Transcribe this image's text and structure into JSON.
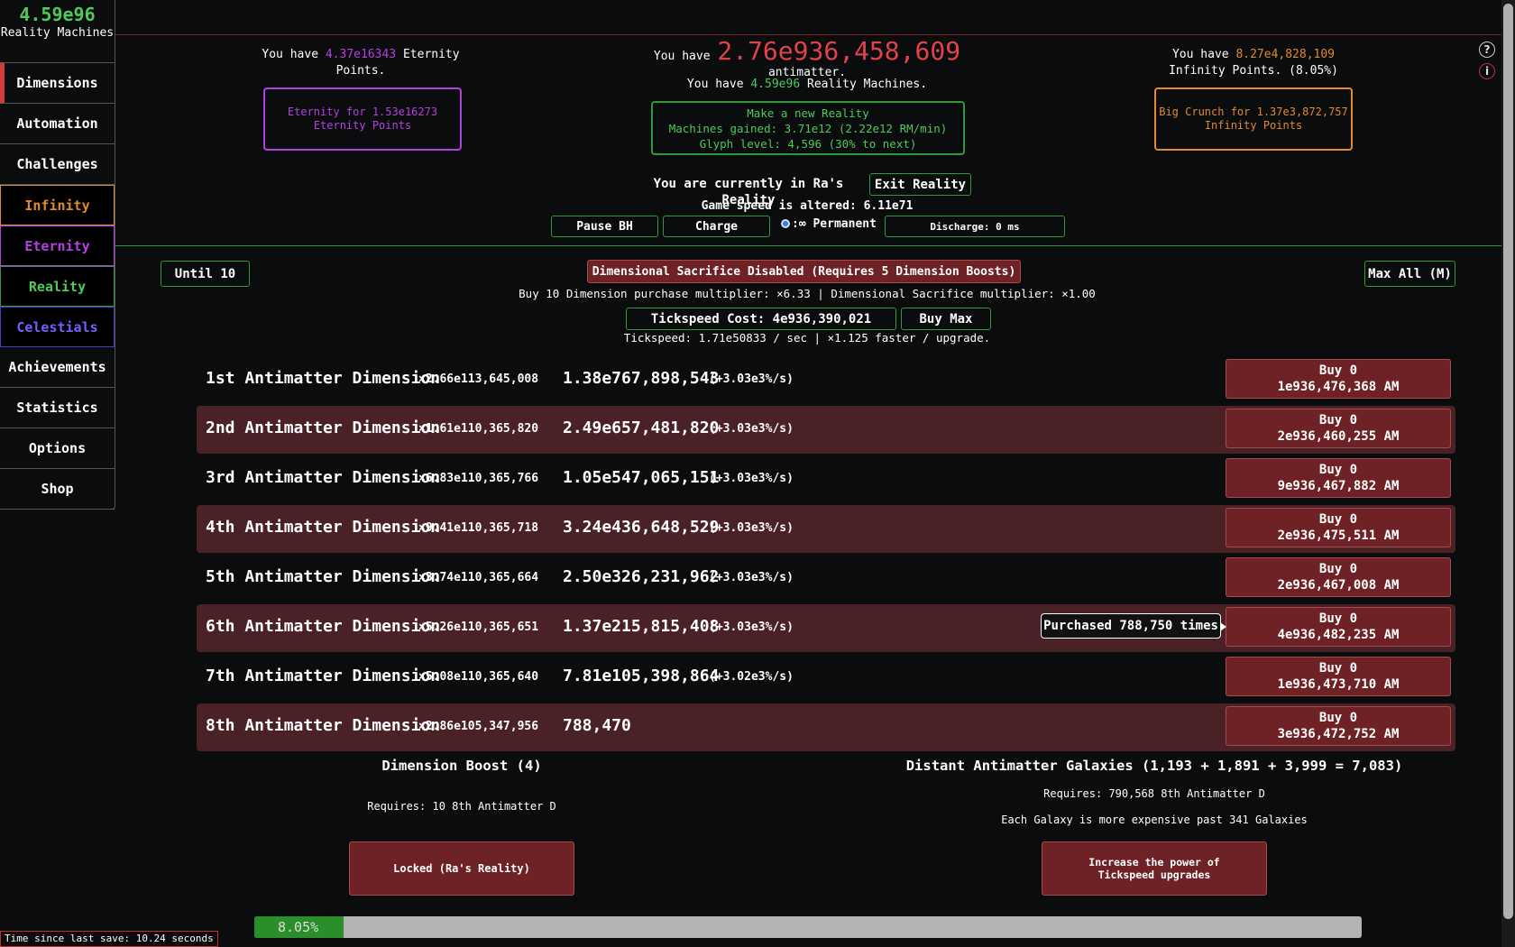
{
  "sidebar": {
    "reality_machines_amount": "4.59e96",
    "reality_machines_label": "Reality Machines",
    "items": [
      {
        "label": "Dimensions",
        "color": "#ffffff"
      },
      {
        "label": "Automation",
        "color": "#ffffff"
      },
      {
        "label": "Challenges",
        "color": "#ffffff"
      },
      {
        "label": "Infinity",
        "color": "#e08a2e"
      },
      {
        "label": "Eternity",
        "color": "#b341e0"
      },
      {
        "label": "Reality",
        "color": "#4ec95a"
      },
      {
        "label": "Celestials",
        "color": "#7a5cff"
      },
      {
        "label": "Achievements",
        "color": "#ffffff"
      },
      {
        "label": "Statistics",
        "color": "#ffffff"
      },
      {
        "label": "Options",
        "color": "#ffffff"
      },
      {
        "label": "Shop",
        "color": "#ffffff"
      }
    ]
  },
  "header": {
    "eternity": {
      "prefix": "You have",
      "amount": "4.37e16343",
      "suffix": "Eternity Points.",
      "button_line1": "Eternity for 1.53e16273",
      "button_line2": "Eternity Points",
      "color": "#b341e0"
    },
    "antimatter": {
      "prefix": "You have",
      "amount": "2.76e936,458,609",
      "suffix": "antimatter.",
      "rm_prefix": "You have",
      "rm_amount": "4.59e96",
      "rm_suffix": "Reality Machines.",
      "button_line1": "Make a new Reality",
      "button_line2": "Machines gained: 3.71e12 (2.22e12 RM/min)",
      "button_line3": "Glyph level: 4,596 (30% to next)",
      "color": "#e0424a"
    },
    "infinity": {
      "prefix": "You have",
      "amount": "8.27e4,828,109",
      "suffix": "Infinity Points. (8.05%)",
      "button_line1": "Big Crunch for 1.37e3,872,757",
      "button_line2": "Infinity Points",
      "color": "#e08a2e"
    },
    "help_icon": "?",
    "info_icon": "i"
  },
  "reality_status": {
    "text": "You are currently in Ra's Reality",
    "exit_button": "Exit Reality",
    "game_speed": "Game speed is altered: 6.11e71",
    "pause_bh": "Pause BH",
    "charge": "Charge",
    "permanent": ":∞ Permanent",
    "discharge": "Discharge: 0 ms"
  },
  "controls": {
    "until_10": "Until 10",
    "sacrifice": "Dimensional Sacrifice Disabled (Requires 5 Dimension Boosts)",
    "max_all": "Max All (M)",
    "multipliers": "Buy 10 Dimension purchase multiplier: ×6.33 | Dimensional Sacrifice multiplier: ×1.00",
    "tickspeed_cost": "Tickspeed Cost: 4e936,390,021",
    "buy_max": "Buy Max",
    "tickspeed_info": "Tickspeed: 1.71e50833 / sec | ×1.125 faster / upgrade."
  },
  "dimensions": [
    {
      "name": "1st Antimatter Dimension",
      "mult": "×2.66e113,645,008",
      "amount": "1.38e767,898,543",
      "rate": "(+3.03e3%/s)",
      "buy": "Buy 0",
      "cost": "1e936,476,368 AM"
    },
    {
      "name": "2nd Antimatter Dimension",
      "mult": "×1.61e110,365,820",
      "amount": "2.49e657,481,820",
      "rate": "(+3.03e3%/s)",
      "buy": "Buy 0",
      "cost": "2e936,460,255 AM"
    },
    {
      "name": "3rd Antimatter Dimension",
      "mult": "×6.83e110,365,766",
      "amount": "1.05e547,065,151",
      "rate": "(+3.03e3%/s)",
      "buy": "Buy 0",
      "cost": "9e936,467,882 AM"
    },
    {
      "name": "4th Antimatter Dimension",
      "mult": "×9.41e110,365,718",
      "amount": "3.24e436,648,529",
      "rate": "(+3.03e3%/s)",
      "buy": "Buy 0",
      "cost": "2e936,475,511 AM"
    },
    {
      "name": "5th Antimatter Dimension",
      "mult": "×3.74e110,365,664",
      "amount": "2.50e326,231,962",
      "rate": "(+3.03e3%/s)",
      "buy": "Buy 0",
      "cost": "2e936,467,008 AM"
    },
    {
      "name": "6th Antimatter Dimension",
      "mult": "×5.26e110,365,651",
      "amount": "1.37e215,815,408",
      "rate": "(+3.03e3%/s)",
      "buy": "Buy 0",
      "cost": "4e936,482,235 AM"
    },
    {
      "name": "7th Antimatter Dimension",
      "mult": "×5.08e110,365,640",
      "amount": "7.81e105,398,864",
      "rate": "(+3.02e3%/s)",
      "buy": "Buy 0",
      "cost": "1e936,473,710 AM"
    },
    {
      "name": "8th Antimatter Dimension",
      "mult": "×2.86e105,347,956",
      "amount": "788,470",
      "rate": "",
      "buy": "Buy 0",
      "cost": "3e936,472,752 AM"
    }
  ],
  "tooltip": "Purchased 788,750 times",
  "boost": {
    "title": "Dimension Boost (4)",
    "requires": "Requires: 10 8th Antimatter D",
    "button": "Locked (Ra's Reality)"
  },
  "galaxy": {
    "title": "Distant Antimatter Galaxies (1,193 + 1,891 + 3,999 = 7,083)",
    "requires": "Requires: 790,568 8th Antimatter D",
    "note": "Each Galaxy is more expensive past 341 Galaxies",
    "button": "Increase the power of Tickspeed upgrades"
  },
  "progress": {
    "value": 0.0805,
    "label": "8.05%"
  },
  "save_time": "Time since last save: 10.24 seconds"
}
